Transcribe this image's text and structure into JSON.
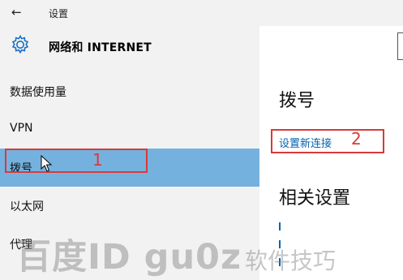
{
  "window": {
    "back_icon": "back-arrow-icon",
    "title": "设置"
  },
  "section": {
    "icon": "gear-icon",
    "title": "网络和 INTERNET"
  },
  "nav": {
    "items": [
      {
        "label": "数据使用量"
      },
      {
        "label": "VPN"
      },
      {
        "label": "拨号",
        "selected": true
      },
      {
        "label": "以太网"
      },
      {
        "label": "代理"
      }
    ],
    "selected_color": "#75b1de"
  },
  "main": {
    "title": "拨号",
    "new_connection_link": "设置新连接",
    "related_title": "相关设置",
    "link_color": "#0063b1"
  },
  "annotations": {
    "color": "#d83a3a",
    "label_1": "1",
    "label_2": "2"
  },
  "watermark": {
    "big": "百度ID gu0z",
    "small": "软件技巧"
  }
}
